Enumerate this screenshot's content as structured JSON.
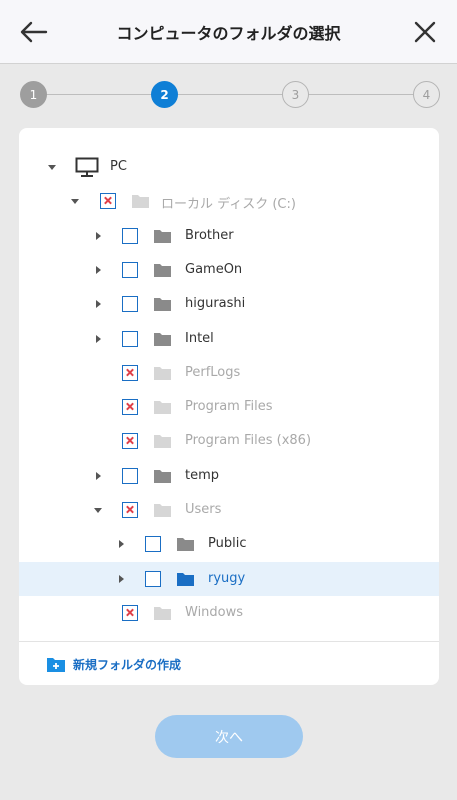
{
  "header": {
    "title": "コンピュータのフォルダの選択"
  },
  "stepper": {
    "steps": [
      "1",
      "2",
      "3",
      "4"
    ],
    "current": 2
  },
  "tree": {
    "root": "PC",
    "drive": "ローカル ディスク (C:)",
    "items": [
      {
        "label": "Brother",
        "state": "unchecked",
        "expandable": true
      },
      {
        "label": "GameOn",
        "state": "unchecked",
        "expandable": true
      },
      {
        "label": "higurashi",
        "state": "unchecked",
        "expandable": true
      },
      {
        "label": "Intel",
        "state": "unchecked",
        "expandable": true
      },
      {
        "label": "PerfLogs",
        "state": "excluded",
        "expandable": false
      },
      {
        "label": "Program Files",
        "state": "excluded",
        "expandable": false
      },
      {
        "label": "Program Files (x86)",
        "state": "excluded",
        "expandable": false
      },
      {
        "label": "temp",
        "state": "unchecked",
        "expandable": true
      },
      {
        "label": "Users",
        "state": "excluded",
        "expandable": true,
        "expanded": true
      },
      {
        "label": "Public",
        "state": "unchecked",
        "expandable": true
      },
      {
        "label": "ryugy",
        "state": "unchecked",
        "expandable": true,
        "selected": true
      },
      {
        "label": "Windows",
        "state": "excluded",
        "expandable": false
      }
    ]
  },
  "new_folder_label": "新規フォルダの作成",
  "next_button": "次へ",
  "colors": {
    "accent": "#0f7fd6",
    "link": "#1a6ec4",
    "excluded_mark": "#e0404a",
    "disabled_button": "#9fc9ef"
  }
}
